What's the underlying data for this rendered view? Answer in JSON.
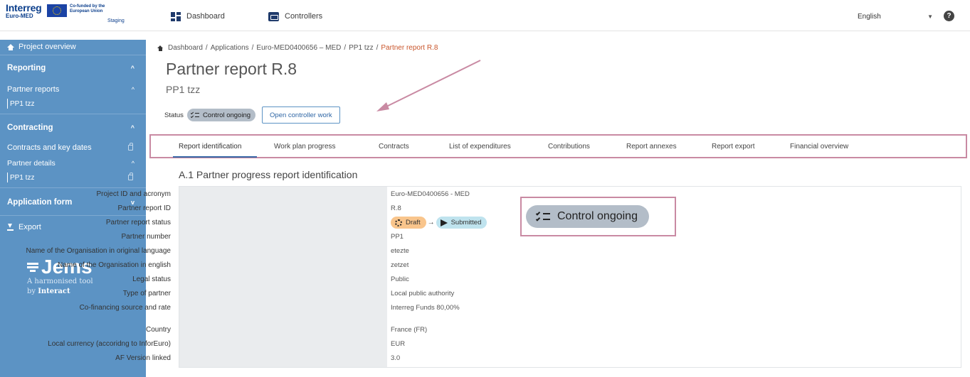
{
  "topbar": {
    "brand_wordmark": "Interreg",
    "brand_submark": "Euro-MED",
    "cofunded": "Co-funded by the European Union",
    "staging": "Staging",
    "nav": [
      {
        "label": "Dashboard",
        "icon": "dashboard-icon"
      },
      {
        "label": "Controllers",
        "icon": "controllers-icon"
      }
    ],
    "language": "English",
    "help_symbol": "?"
  },
  "sidebar": {
    "project_overview": "Project overview",
    "reporting": "Reporting",
    "partner_reports": "Partner reports",
    "partner_reports_item": "PP1 tzz",
    "contracting": "Contracting",
    "contracts_key_dates": "Contracts and key dates",
    "partner_details": "Partner details",
    "partner_details_item": "PP1 tzz",
    "application_form": "Application form",
    "export": "Export",
    "jems_logo": "Jems",
    "jems_tagline_1": "A harmonised tool",
    "jems_tagline_2_prefix": "by ",
    "jems_tagline_2_brand": "Interact"
  },
  "breadcrumb": [
    "Dashboard",
    "Applications",
    "Euro-MED0400656 – MED",
    "PP1 tzz",
    "Partner report R.8"
  ],
  "page": {
    "title": "Partner report R.8",
    "subtitle": "PP1 tzz",
    "status_label": "Status",
    "status_value": "Control ongoing",
    "open_controller_button": "Open controller work"
  },
  "tabs": [
    "Report identification",
    "Work plan progress",
    "Contracts",
    "List of expenditures",
    "Contributions",
    "Report annexes",
    "Report export",
    "Financial overview"
  ],
  "section": {
    "title": "A.1 Partner progress report identification",
    "rows": [
      {
        "label": "Project ID and acronym",
        "value": "Euro-MED0400656 - MED"
      },
      {
        "label": "Partner report ID",
        "value": "R.8"
      },
      {
        "label": "Partner report status",
        "value": ""
      },
      {
        "label": "Partner number",
        "value": "PP1"
      },
      {
        "label": "Name of the Organisation in original language",
        "value": "etezte"
      },
      {
        "label": "Name of the Organisation in english",
        "value": "zetzet"
      },
      {
        "label": "Legal status",
        "value": "Public"
      },
      {
        "label": "Type of partner",
        "value": "Local public authority"
      },
      {
        "label": "Co-financing source and rate",
        "value": "Interreg Funds 80,00%"
      },
      {
        "label": "Country",
        "value": "France (FR)"
      },
      {
        "label": "Local currency (accoridng to InforEuro)",
        "value": "EUR"
      },
      {
        "label": "AF Version linked",
        "value": "3.0"
      }
    ],
    "status_flow": [
      "Draft",
      "Submitted"
    ],
    "flow_arrow": "→"
  },
  "zoom": {
    "status_value": "Control ongoing"
  },
  "colors": {
    "sidebar_bg": "#5c93c4",
    "highlight": "#c98aa3",
    "breadcrumb_active": "#c9552b",
    "draft": "#f9c58c",
    "submitted": "#bfe3ee",
    "control_chip": "#b3bdc8"
  }
}
